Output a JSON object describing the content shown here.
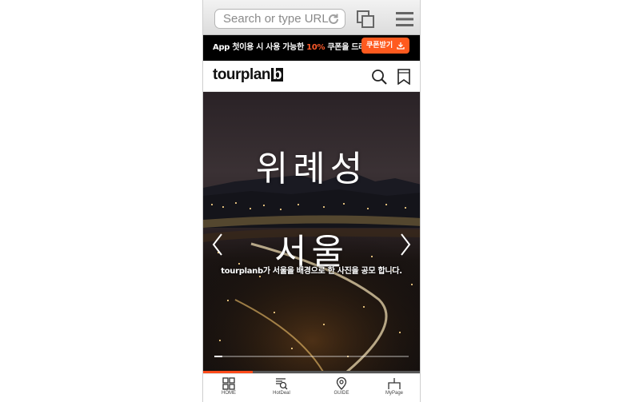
{
  "browser": {
    "url_placeholder": "Search or type URL"
  },
  "promo": {
    "text_before": "App 첫이용 시 사용 가능한 ",
    "percent": "10%",
    "text_after": " 쿠폰을 드려요",
    "button_label": "쿠폰받기"
  },
  "header": {
    "logo_text": "tourplan",
    "logo_badge": "b"
  },
  "hero": {
    "title_line1": "위례성",
    "title_line2": "서울",
    "subtitle": "tourplanb가 서울을 배경으로 한 사진을 공모 합니다.",
    "slide_progress": 0.04,
    "page_progress": 0.23
  },
  "bottom_nav": {
    "items": [
      {
        "label": "HOME",
        "icon": "grid-icon"
      },
      {
        "label": "HotDeal",
        "icon": "hotdeal-search-icon"
      },
      {
        "label": "GUIDE",
        "icon": "map-pin-icon"
      },
      {
        "label": "MyPage",
        "icon": "mypage-icon"
      }
    ]
  },
  "colors": {
    "accent": "#ff5a1e",
    "promo_bg": "#000000"
  }
}
